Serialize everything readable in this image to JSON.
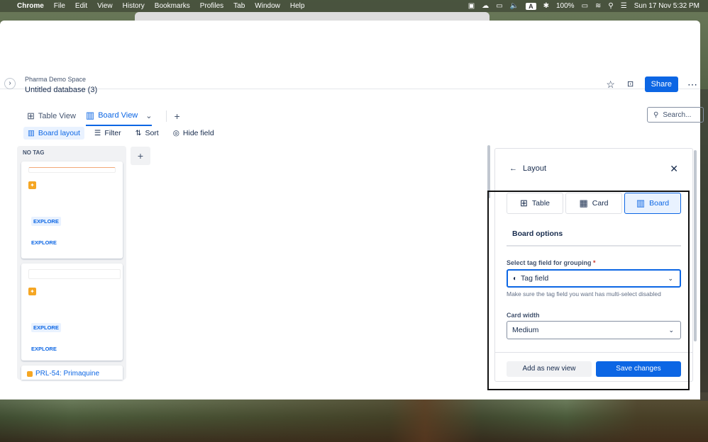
{
  "menubar": {
    "app": "Chrome",
    "items": [
      "File",
      "Edit",
      "View",
      "History",
      "Bookmarks",
      "Profiles",
      "Tab",
      "Window",
      "Help"
    ],
    "status_a": "A",
    "battery": "100%",
    "datetime": "Sun 17 Nov  5:32 PM"
  },
  "header": {
    "breadcrumb": "Pharma Demo Space",
    "title": "Untitled database (3)",
    "share_label": "Share",
    "expand_icon": "›",
    "star_icon": "☆",
    "lock_icon": "🔓",
    "more_icon": "⋯"
  },
  "views": {
    "tabs": [
      {
        "label": "Table View",
        "icon": "table-icon"
      },
      {
        "label": "Board View",
        "icon": "board-icon"
      }
    ],
    "dropdown_icon": "⌄",
    "add_icon": "+",
    "search_placeholder": "Search..."
  },
  "toolbar": {
    "board_layout": "Board layout",
    "filter": "Filter",
    "sort": "Sort",
    "hide_field": "Hide field"
  },
  "board": {
    "column_header": "NO TAG",
    "add_column": "+",
    "cards": [
      {
        "tags": [
          "EXPLORE",
          "EXPLORE"
        ]
      },
      {
        "tags": [
          "EXPLORE",
          "EXPLORE"
        ]
      }
    ],
    "partial_card_title": "PRL-54: Primaquine"
  },
  "layout_panel": {
    "title": "Layout",
    "back_icon": "←",
    "close_icon": "✕",
    "segments": [
      {
        "label": "Table",
        "icon": "table-icon"
      },
      {
        "label": "Card",
        "icon": "card-grid-icon"
      },
      {
        "label": "Board",
        "icon": "board-icon"
      }
    ],
    "selected_segment": "Board",
    "options_tab": "Board options",
    "group_label": "Select tag field for grouping",
    "required_mark": "*",
    "group_value": "Tag field",
    "group_help": "Make sure the tag field you want has multi-select disabled",
    "width_label": "Card width",
    "width_value": "Medium",
    "secondary_button": "Add as new view",
    "primary_button": "Save changes"
  }
}
